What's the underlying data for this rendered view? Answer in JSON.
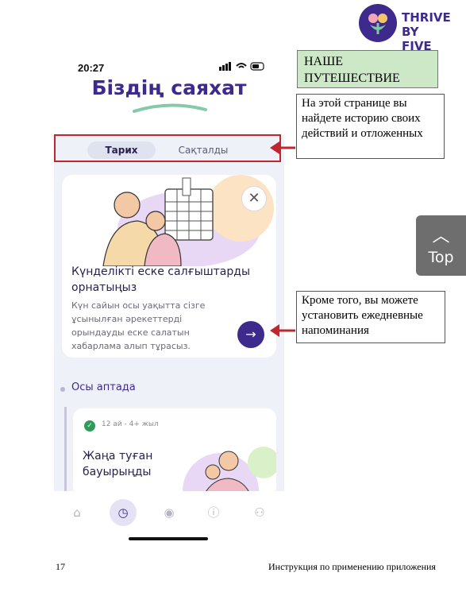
{
  "logo": {
    "line1": "THRIVE",
    "line2": "BY FIVE"
  },
  "status": {
    "time": "20:27",
    "icons": "▪▪▪ ◠ ▭"
  },
  "app": {
    "title": "Біздің саяхат",
    "tabs": [
      {
        "label": "Тарих",
        "active": true
      },
      {
        "label": "Сақталды",
        "active": false
      }
    ],
    "reminder_card": {
      "title": "Күнделікті еске салғыштарды орнатыңыз",
      "body": "Күн сайын осы уақытта сізге ұсынылған әрекеттерді орындауды еске салатын хабарлама алып тұрасыз.",
      "close_icon": "close-icon",
      "arrow_icon": "arrow-right-icon"
    },
    "section_title": "Осы аптада",
    "activity_card": {
      "age_range": "12 ай - 4+ жыл",
      "title": "Жаңа туған бауырыңды"
    },
    "nav": [
      "home-icon",
      "journey-icon",
      "explore-icon",
      "info-icon",
      "people-icon"
    ]
  },
  "annotations": {
    "title_note": "НАШЕ ПУТЕШЕСТВИЕ",
    "note1": "На этой странице вы найдете историю своих действий и отложенных",
    "note2": "Кроме того, вы можете установить ежедневные напоминания"
  },
  "top_button": {
    "label": "Top"
  },
  "footer": {
    "page_number": "17",
    "doc_title": "Инструкция по применению приложения"
  },
  "colors": {
    "brand": "#3d2a8c",
    "annotation_red": "#c0262d",
    "note_green": "#cde8c6"
  }
}
